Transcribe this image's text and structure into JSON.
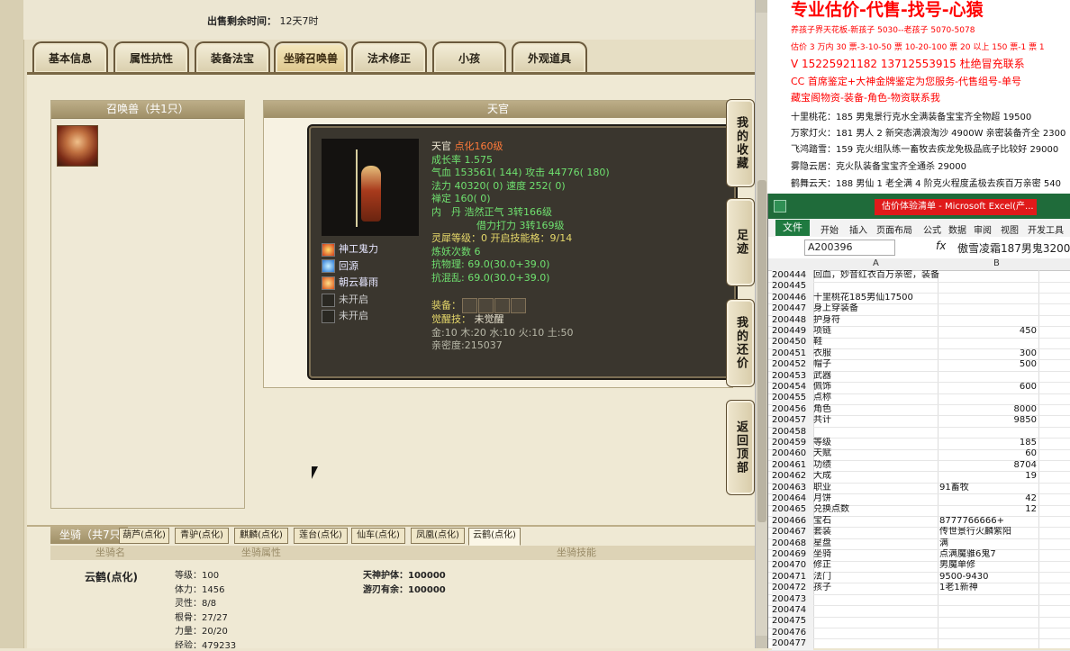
{
  "top": {
    "sell_time_label": "出售剩余时间：",
    "sell_time_value": "12天7时"
  },
  "tabs": [
    "基本信息",
    "属性抗性",
    "装备法宝",
    "坐骑召唤兽",
    "法术修正",
    "小孩",
    "外观道具"
  ],
  "summon_panel": {
    "title": "召唤兽（共1只）"
  },
  "detail_panel": {
    "title": "天官"
  },
  "pet": {
    "name": "天官",
    "level": "点化160级",
    "growth": "成长率 1.575",
    "hp_label": "气血 ",
    "hp": "153561( 144)",
    "atk": " 攻击 44776( 180)",
    "mp": "法力 40320( 0) 速度 252( 0)",
    "calm": "禅定 160( 0)",
    "dan": "内　丹 浩然正气 3转166级",
    "borrow": "借力打力 3转169级",
    "spirit": "灵犀等级：0 开启技能格：9/14",
    "refine": "炼妖次数 6",
    "res1": "抗物理: 69.0(30.0+39.0)",
    "res2": "抗混乱: 69.0(30.0+39.0)",
    "equip_label": "装备：",
    "awaken_label": "觉醒技：",
    "awaken_value": " 未觉醒",
    "elements": "金:10 木:20 水:10 火:10 土:50",
    "intimacy": "亲密度:215037"
  },
  "skills": [
    {
      "label": "神工鬼力",
      "icon": "fire-skill-icon"
    },
    {
      "label": "回源",
      "icon": "water-skill-icon"
    },
    {
      "label": "朝云暮雨",
      "icon": "sun-skill-icon"
    },
    {
      "label": "未开启",
      "icon": "lock-icon"
    },
    {
      "label": "未开启",
      "icon": "lock-icon"
    }
  ],
  "side_buttons": [
    "我的收藏",
    "足迹",
    "我的还价",
    "返回顶部"
  ],
  "mounts": {
    "title": "坐骑（共7只）",
    "tabs": [
      "葫芦(点化)",
      "青驴(点化)",
      "麒麟(点化)",
      "莲台(点化)",
      "仙车(点化)",
      "凤凰(点化)",
      "云鹤(点化)"
    ],
    "headers": [
      "坐骑名",
      "坐骑属性",
      "坐骑技能"
    ],
    "name": "云鹤(点化)",
    "attrs": [
      "等级：100",
      "体力：1456",
      "灵性：8/8",
      "根骨：27/27",
      "力量：20/20",
      "经验：479233"
    ],
    "skills": [
      "天神护体：100000",
      "游刃有余：100000"
    ]
  },
  "ad": {
    "title": "专业估价-代售-找号-心猿",
    "lines": [
      {
        "text": "养孩子界天花板-新孩子 5030--老孩子 5070-5078",
        "color": "#ff0000"
      },
      {
        "text": "估价 3 万内 30 票-3-10-50 票 10-20-100 票 20 以上 150 票-1 票 1",
        "color": "#ff0000"
      },
      {
        "text": "V 15225921182     13712553915   杜绝冒充联系",
        "color": "#ff0000"
      },
      {
        "text": "CC 首席鉴定+大神金牌鉴定为您服务-代售组号-单号",
        "color": "#ff0000"
      },
      {
        "text": "藏宝阁物资-装备-角色-物资联系我",
        "color": "#ff0000"
      },
      {
        "text": "十里桃花：185 男鬼景行克水全满装备宝宝齐全物超 19500",
        "color": "#111111"
      },
      {
        "text": "万家灯火：181 男人 2 新突态满浪淘沙 4900W 亲密装备齐全 2300",
        "color": "#111111"
      },
      {
        "text": "飞鸿踏雪：159 克火组队练一畜牧去疾龙免极品底子比较好 29000",
        "color": "#111111"
      },
      {
        "text": "雾隐云居：克火队装备宝宝齐全通杀 29000",
        "color": "#111111"
      },
      {
        "text": "鹤舞云天：188 男仙 1 老全满 4 阶克火程度孟极去疾百万亲密 540",
        "color": "#111111"
      }
    ]
  },
  "excel": {
    "title": "估价体验清单 - Microsoft Excel(产...",
    "file": "文件",
    "menus": [
      "开始",
      "插入",
      "页面布局",
      "公式",
      "数据",
      "审阅",
      "视图",
      "开发工具"
    ],
    "namebox": "A200396",
    "fx": "fx",
    "formula": "傲雪凌霜187男鬼3200",
    "col_a": "A",
    "col_b": "B",
    "rows": [
      {
        "n": "200444",
        "a": "回血，妙音红衣百万亲密，装备宝宝齐全",
        "b": ""
      },
      {
        "n": "200445",
        "a": "",
        "b": ""
      },
      {
        "n": "200446",
        "a": "十里桃花185男仙17500",
        "b": ""
      },
      {
        "n": "200447",
        "a": "身上穿装备",
        "b": ""
      },
      {
        "n": "200448",
        "a": "护身符",
        "b": ""
      },
      {
        "n": "200449",
        "a": "项链",
        "b": "450"
      },
      {
        "n": "200450",
        "a": "鞋",
        "b": ""
      },
      {
        "n": "200451",
        "a": "衣服",
        "b": "300"
      },
      {
        "n": "200452",
        "a": "帽子",
        "b": "500"
      },
      {
        "n": "200453",
        "a": "武器",
        "b": ""
      },
      {
        "n": "200454",
        "a": "佩饰",
        "b": "600"
      },
      {
        "n": "200455",
        "a": "点称",
        "b": ""
      },
      {
        "n": "200456",
        "a": "角色",
        "b": "8000"
      },
      {
        "n": "200457",
        "a": "共计",
        "b": "9850"
      },
      {
        "n": "200458",
        "a": "",
        "b": ""
      },
      {
        "n": "200459",
        "a": "等级",
        "b": "185"
      },
      {
        "n": "200460",
        "a": "天赋",
        "b": "60"
      },
      {
        "n": "200461",
        "a": "功绩",
        "b": "8704"
      },
      {
        "n": "200462",
        "a": "大成",
        "b": "19"
      },
      {
        "n": "200463",
        "a": "职业",
        "b": "91畜牧",
        "txt": true
      },
      {
        "n": "200464",
        "a": "月饼",
        "b": "42"
      },
      {
        "n": "200465",
        "a": "兑换点数",
        "b": "12"
      },
      {
        "n": "200466",
        "a": "宝石",
        "b": "8777766666+",
        "txt": true
      },
      {
        "n": "200467",
        "a": "套装",
        "b": "传世景行火麟紫阳",
        "txt": true
      },
      {
        "n": "200468",
        "a": "星盘",
        "b": "满",
        "txt": true
      },
      {
        "n": "200469",
        "a": "坐骑",
        "b": "点满魔骓6鬼7",
        "txt": true
      },
      {
        "n": "200470",
        "a": "修正",
        "b": "男魔单修",
        "txt": true
      },
      {
        "n": "200471",
        "a": "法门",
        "b": "9500-9430",
        "txt": true
      },
      {
        "n": "200472",
        "a": "孩子",
        "b": "1老1新神",
        "txt": true
      },
      {
        "n": "200473",
        "a": "",
        "b": ""
      },
      {
        "n": "200474",
        "a": "",
        "b": ""
      },
      {
        "n": "200475",
        "a": "",
        "b": ""
      },
      {
        "n": "200476",
        "a": "",
        "b": ""
      },
      {
        "n": "200477",
        "a": "",
        "b": ""
      }
    ]
  }
}
